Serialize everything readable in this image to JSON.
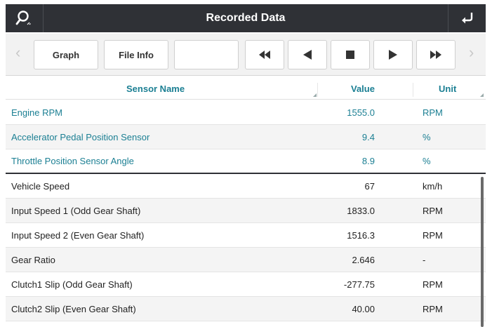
{
  "app": {
    "title": "Recorded Data"
  },
  "toolbar": {
    "buttons": [
      "Graph",
      "File Info",
      ""
    ],
    "controls": [
      "rewind",
      "prev",
      "stop",
      "play",
      "fast-forward"
    ]
  },
  "table": {
    "headers": {
      "name": "Sensor Name",
      "value": "Value",
      "unit": "Unit"
    },
    "rows": [
      {
        "name": "Engine RPM",
        "value": "1555.0",
        "unit": "RPM"
      },
      {
        "name": "Accelerator Pedal Position Sensor",
        "value": "9.4",
        "unit": "%"
      },
      {
        "name": "Throttle Position Sensor Angle",
        "value": "8.9",
        "unit": "%"
      },
      {
        "name": "Vehicle Speed",
        "value": "67",
        "unit": "km/h"
      },
      {
        "name": "Input Speed 1 (Odd Gear Shaft)",
        "value": "1833.0",
        "unit": "RPM"
      },
      {
        "name": "Input Speed 2 (Even Gear Shaft)",
        "value": "1516.3",
        "unit": "RPM"
      },
      {
        "name": "Gear Ratio",
        "value": "2.646",
        "unit": "-"
      },
      {
        "name": "Clutch1 Slip (Odd Gear Shaft)",
        "value": "-277.75",
        "unit": "RPM"
      },
      {
        "name": "Clutch2 Slip (Even Gear Shaft)",
        "value": "40.00",
        "unit": "RPM"
      }
    ]
  },
  "colors": {
    "titlebar": "#2f3136",
    "accent": "#1b7f93"
  },
  "icons": {
    "search": "search-icon",
    "back": "return-icon"
  }
}
